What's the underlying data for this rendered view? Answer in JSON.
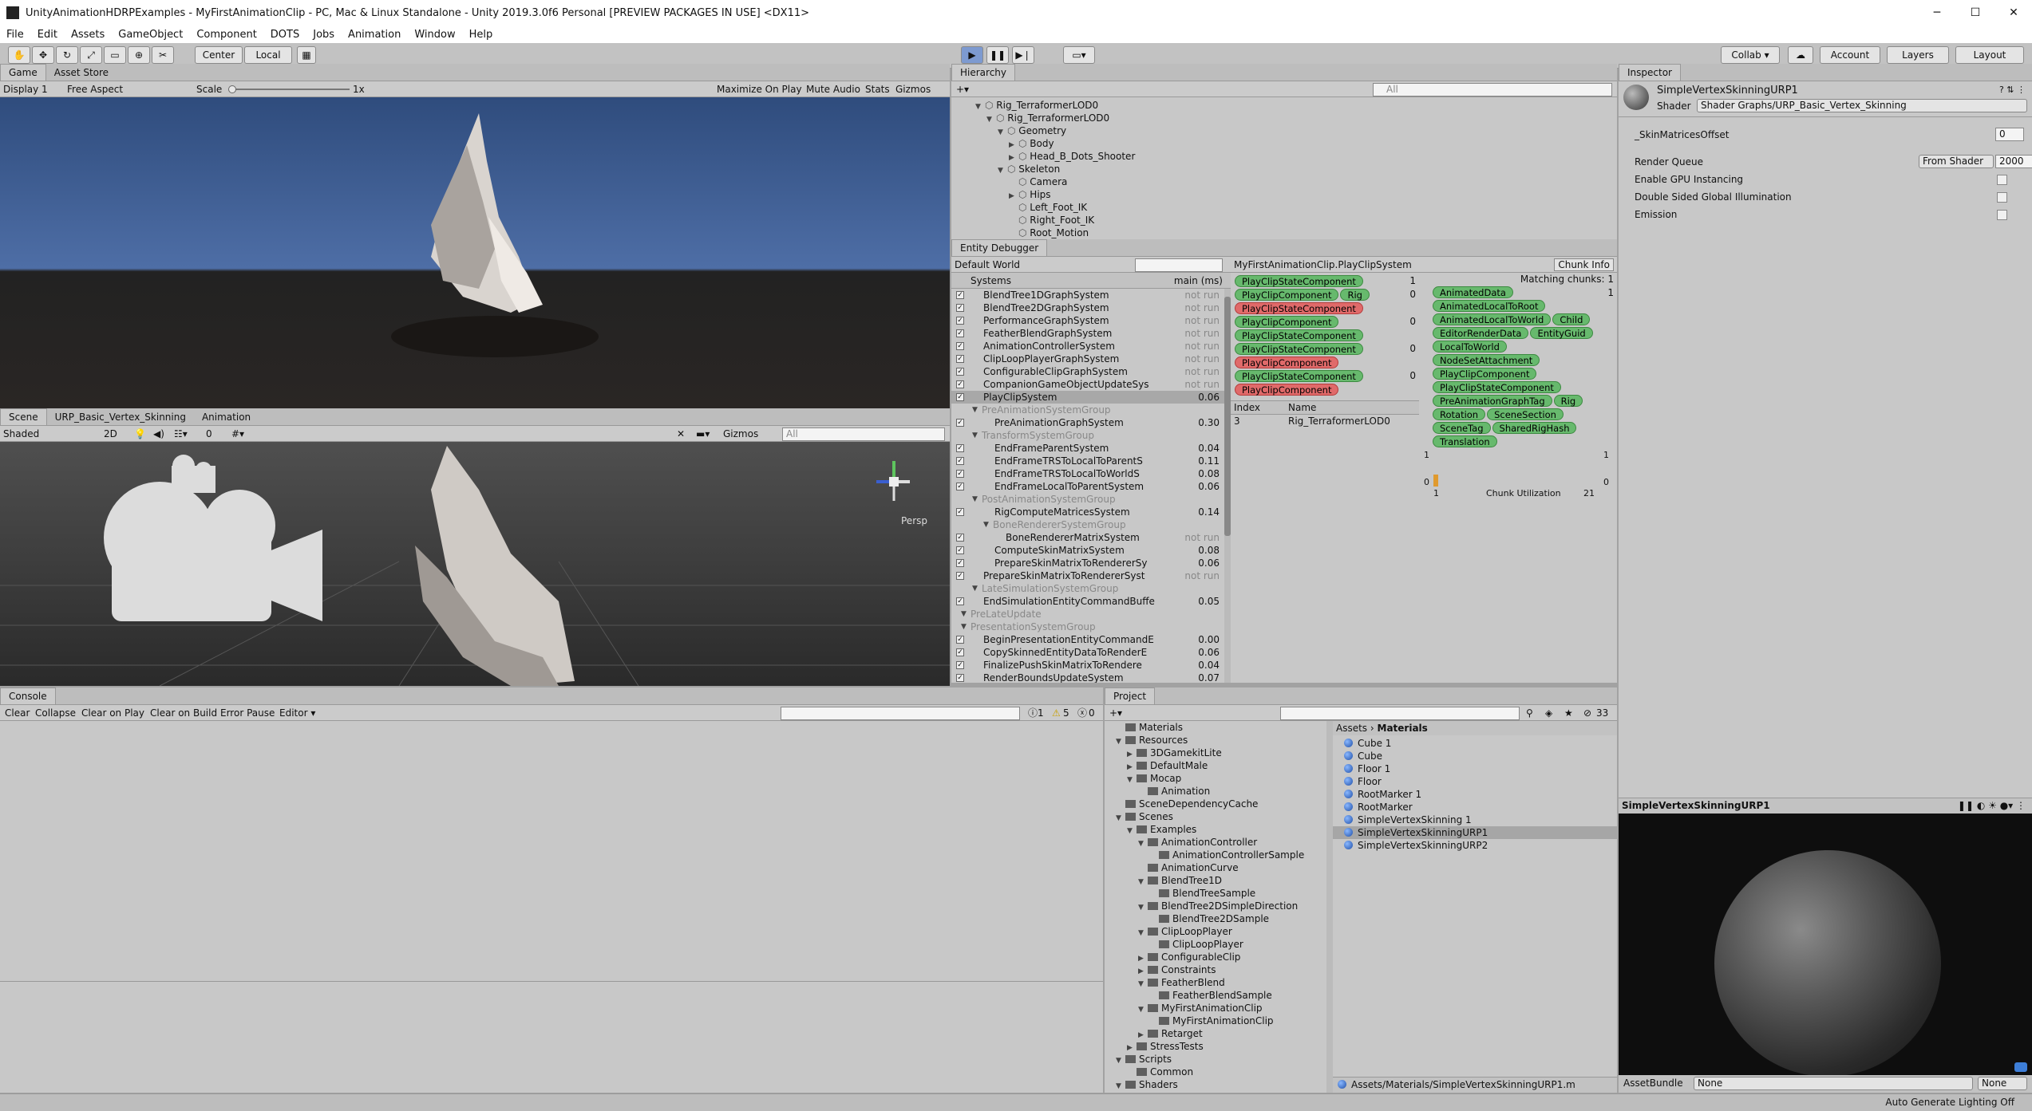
{
  "window": {
    "title": "UnityAnimationHDRPExamples - MyFirstAnimationClip - PC, Mac & Linux Standalone - Unity 2019.3.0f6 Personal [PREVIEW PACKAGES IN USE] <DX11>",
    "minimize": "─",
    "maximize": "☐",
    "close": "✕"
  },
  "menu": [
    "File",
    "Edit",
    "Assets",
    "GameObject",
    "Component",
    "DOTS",
    "Jobs",
    "Animation",
    "Window",
    "Help"
  ],
  "toolbar": {
    "center": "Center",
    "local": "Local",
    "collab": "Collab ▾",
    "account": "Account",
    "layers": "Layers",
    "layout": "Layout"
  },
  "game": {
    "tab": "Game",
    "tab2": "Asset Store",
    "display": "Display 1",
    "aspect": "Free Aspect",
    "scale_label": "Scale",
    "scale_value": "1x",
    "maximize": "Maximize On Play",
    "mute": "Mute Audio",
    "stats": "Stats",
    "gizmos": "Gizmos"
  },
  "scene": {
    "tab": "Scene",
    "tab2": "URP_Basic_Vertex_Skinning",
    "tab3": "Animation",
    "shading": "Shaded",
    "mode2d": "2D",
    "gizmos": "Gizmos",
    "search_placeholder": "All",
    "persp": "Persp",
    "layer_count": "0"
  },
  "hierarchy": {
    "tab": "Hierarchy",
    "search_placeholder": "All",
    "items": [
      {
        "label": "Rig_TerraformerLOD0",
        "depth": 0,
        "arrow": "▼"
      },
      {
        "label": "Rig_TerraformerLOD0",
        "depth": 1,
        "arrow": "▼"
      },
      {
        "label": "Geometry",
        "depth": 2,
        "arrow": "▼"
      },
      {
        "label": "Body",
        "depth": 3,
        "arrow": "▶"
      },
      {
        "label": "Head_B_Dots_Shooter",
        "depth": 3,
        "arrow": "▶"
      },
      {
        "label": "Skeleton",
        "depth": 2,
        "arrow": "▼"
      },
      {
        "label": "Camera",
        "depth": 3,
        "arrow": ""
      },
      {
        "label": "Hips",
        "depth": 3,
        "arrow": "▶"
      },
      {
        "label": "Left_Foot_IK",
        "depth": 3,
        "arrow": ""
      },
      {
        "label": "Right_Foot_IK",
        "depth": 3,
        "arrow": ""
      },
      {
        "label": "Root_Motion",
        "depth": 3,
        "arrow": ""
      }
    ]
  },
  "entity_debugger": {
    "tab": "Entity Debugger",
    "world": "Default World",
    "systems_header": "Systems",
    "main_header": "main (ms)",
    "systems": [
      {
        "label": "BlendTree1DGraphSystem",
        "time": "not run",
        "indent": 1,
        "checked": true,
        "group": false
      },
      {
        "label": "BlendTree2DGraphSystem",
        "time": "not run",
        "indent": 1,
        "checked": true,
        "group": false
      },
      {
        "label": "PerformanceGraphSystem",
        "time": "not run",
        "indent": 1,
        "checked": true,
        "group": false
      },
      {
        "label": "FeatherBlendGraphSystem",
        "time": "not run",
        "indent": 1,
        "checked": true,
        "group": false
      },
      {
        "label": "AnimationControllerSystem",
        "time": "not run",
        "indent": 1,
        "checked": true,
        "group": false
      },
      {
        "label": "ClipLoopPlayerGraphSystem",
        "time": "not run",
        "indent": 1,
        "checked": true,
        "group": false
      },
      {
        "label": "ConfigurableClipGraphSystem",
        "time": "not run",
        "indent": 1,
        "checked": true,
        "group": false
      },
      {
        "label": "CompanionGameObjectUpdateSys",
        "time": "not run",
        "indent": 1,
        "checked": true,
        "group": false
      },
      {
        "label": "PlayClipSystem",
        "time": "0.06",
        "indent": 1,
        "checked": true,
        "group": false,
        "selected": true
      },
      {
        "label": "PreAnimationSystemGroup",
        "time": "",
        "indent": 1,
        "checked": false,
        "group": true
      },
      {
        "label": "PreAnimationGraphSystem",
        "time": "0.30",
        "indent": 2,
        "checked": true,
        "group": false
      },
      {
        "label": "TransformSystemGroup",
        "time": "",
        "indent": 1,
        "checked": false,
        "group": true
      },
      {
        "label": "EndFrameParentSystem",
        "time": "0.04",
        "indent": 2,
        "checked": true,
        "group": false
      },
      {
        "label": "EndFrameTRSToLocalToParentS",
        "time": "0.11",
        "indent": 2,
        "checked": true,
        "group": false
      },
      {
        "label": "EndFrameTRSToLocalToWorldS",
        "time": "0.08",
        "indent": 2,
        "checked": true,
        "group": false
      },
      {
        "label": "EndFrameLocalToParentSystem",
        "time": "0.06",
        "indent": 2,
        "checked": true,
        "group": false
      },
      {
        "label": "PostAnimationSystemGroup",
        "time": "",
        "indent": 1,
        "checked": false,
        "group": true
      },
      {
        "label": "RigComputeMatricesSystem",
        "time": "0.14",
        "indent": 2,
        "checked": true,
        "group": false
      },
      {
        "label": "BoneRendererSystemGroup",
        "time": "",
        "indent": 2,
        "checked": false,
        "group": true
      },
      {
        "label": "BoneRendererMatrixSystem",
        "time": "not run",
        "indent": 3,
        "checked": true,
        "group": false
      },
      {
        "label": "ComputeSkinMatrixSystem",
        "time": "0.08",
        "indent": 2,
        "checked": true,
        "group": false
      },
      {
        "label": "PrepareSkinMatrixToRendererSy",
        "time": "0.06",
        "indent": 2,
        "checked": true,
        "group": false
      },
      {
        "label": "PrepareSkinMatrixToRendererSyst",
        "time": "not run",
        "indent": 1,
        "checked": true,
        "group": false
      },
      {
        "label": "LateSimulationSystemGroup",
        "time": "",
        "indent": 1,
        "checked": false,
        "group": true
      },
      {
        "label": "EndSimulationEntityCommandBuffe",
        "time": "0.05",
        "indent": 1,
        "checked": true,
        "group": false
      },
      {
        "label": "PreLateUpdate",
        "time": "",
        "indent": 0,
        "checked": false,
        "group": true
      },
      {
        "label": "PresentationSystemGroup",
        "time": "",
        "indent": 0,
        "checked": false,
        "group": true
      },
      {
        "label": "BeginPresentationEntityCommandE",
        "time": "0.00",
        "indent": 1,
        "checked": true,
        "group": false
      },
      {
        "label": "CopySkinnedEntityDataToRenderE",
        "time": "0.06",
        "indent": 1,
        "checked": true,
        "group": false
      },
      {
        "label": "FinalizePushSkinMatrixToRendere",
        "time": "0.04",
        "indent": 1,
        "checked": true,
        "group": false
      },
      {
        "label": "RenderBoundsUpdateSystem",
        "time": "0.07",
        "indent": 1,
        "checked": true,
        "group": false
      }
    ],
    "query_title": "MyFirstAnimationClip.PlayClipSystem",
    "chunk_info": "Chunk Info",
    "queries": [
      {
        "pills": [
          {
            "t": "PlayClipStateComponent",
            "red": false
          }
        ],
        "count": "1"
      },
      {
        "pills": [
          {
            "t": "PlayClipComponent",
            "red": false
          },
          {
            "t": "Rig",
            "red": false
          }
        ],
        "count": "0"
      },
      {
        "pills": [
          {
            "t": "PlayClipStateComponent",
            "red": true
          }
        ],
        "count": ""
      },
      {
        "pills": [
          {
            "t": "PlayClipComponent",
            "red": false
          }
        ],
        "count": "0"
      },
      {
        "pills": [
          {
            "t": "PlayClipStateComponent",
            "red": false
          }
        ],
        "count": ""
      },
      {
        "pills": [
          {
            "t": "PlayClipStateComponent",
            "red": false
          }
        ],
        "count": "0"
      },
      {
        "pills": [
          {
            "t": "PlayClipComponent",
            "red": true
          }
        ],
        "count": ""
      },
      {
        "pills": [
          {
            "t": "PlayClipStateComponent",
            "red": false
          }
        ],
        "count": "0"
      },
      {
        "pills": [
          {
            "t": "PlayClipComponent",
            "red": true
          }
        ],
        "count": ""
      }
    ],
    "index_header": "Index",
    "name_header": "Name",
    "entity_index": "3",
    "entity_name": "Rig_TerraformerLOD0",
    "matching_chunks": "Matching chunks: 1",
    "chunk_count": "1",
    "archetype_rows": [
      [
        "AnimatedData"
      ],
      [
        "AnimatedLocalToRoot"
      ],
      [
        "AnimatedLocalToWorld",
        "Child"
      ],
      [
        "EditorRenderData",
        "EntityGuid"
      ],
      [
        "LocalToWorld"
      ],
      [
        "NodeSetAttachment"
      ],
      [
        "PlayClipComponent"
      ],
      [
        "PlayClipStateComponent"
      ],
      [
        "PreAnimationGraphTag",
        "Rig"
      ],
      [
        "Rotation",
        "SceneSection"
      ],
      [
        "SceneTag",
        "SharedRigHash"
      ],
      [
        "Translation"
      ]
    ],
    "chunk_util_label": "Chunk Utilization",
    "chunk_axis_min": "1",
    "chunk_axis_max": "21",
    "chunk_y_top": "1",
    "chunk_y_bottom": "0",
    "chunk_right_top": "1",
    "chunk_right_bottom": "0",
    "chunk_fill": 0.33
  },
  "console": {
    "tab": "Console",
    "clear": "Clear",
    "collapse": "Collapse",
    "clear_on_play": "Clear on Play",
    "clear_on_build": "Clear on Build",
    "error_pause": "Error Pause",
    "editor": "Editor ▾",
    "info_count": "1",
    "warn_count": "5",
    "error_count": "0"
  },
  "project": {
    "tab": "Project",
    "count": "33",
    "breadcrumb_root": "Assets",
    "breadcrumb_leaf": "Materials",
    "tree": [
      {
        "label": "Materials",
        "depth": 1,
        "arrow": ""
      },
      {
        "label": "Resources",
        "depth": 1,
        "arrow": "▼"
      },
      {
        "label": "3DGamekitLite",
        "depth": 2,
        "arrow": "▶"
      },
      {
        "label": "DefaultMale",
        "depth": 2,
        "arrow": "▶"
      },
      {
        "label": "Mocap",
        "depth": 2,
        "arrow": "▼"
      },
      {
        "label": "Animation",
        "depth": 3,
        "arrow": ""
      },
      {
        "label": "SceneDependencyCache",
        "depth": 1,
        "arrow": ""
      },
      {
        "label": "Scenes",
        "depth": 1,
        "arrow": "▼"
      },
      {
        "label": "Examples",
        "depth": 2,
        "arrow": "▼"
      },
      {
        "label": "AnimationController",
        "depth": 3,
        "arrow": "▼"
      },
      {
        "label": "AnimationControllerSample",
        "depth": 4,
        "arrow": ""
      },
      {
        "label": "AnimationCurve",
        "depth": 3,
        "arrow": ""
      },
      {
        "label": "BlendTree1D",
        "depth": 3,
        "arrow": "▼"
      },
      {
        "label": "BlendTreeSample",
        "depth": 4,
        "arrow": ""
      },
      {
        "label": "BlendTree2DSimpleDirection",
        "depth": 3,
        "arrow": "▼"
      },
      {
        "label": "BlendTree2DSample",
        "depth": 4,
        "arrow": ""
      },
      {
        "label": "ClipLoopPlayer",
        "depth": 3,
        "arrow": "▼"
      },
      {
        "label": "ClipLoopPlayer",
        "depth": 4,
        "arrow": ""
      },
      {
        "label": "ConfigurableClip",
        "depth": 3,
        "arrow": "▶"
      },
      {
        "label": "Constraints",
        "depth": 3,
        "arrow": "▶"
      },
      {
        "label": "FeatherBlend",
        "depth": 3,
        "arrow": "▼"
      },
      {
        "label": "FeatherBlendSample",
        "depth": 4,
        "arrow": ""
      },
      {
        "label": "MyFirstAnimationClip",
        "depth": 3,
        "arrow": "▼"
      },
      {
        "label": "MyFirstAnimationClip",
        "depth": 4,
        "arrow": ""
      },
      {
        "label": "Retarget",
        "depth": 3,
        "arrow": "▶"
      },
      {
        "label": "StressTests",
        "depth": 2,
        "arrow": "▶"
      },
      {
        "label": "Scripts",
        "depth": 1,
        "arrow": "▼"
      },
      {
        "label": "Common",
        "depth": 2,
        "arrow": ""
      },
      {
        "label": "Shaders",
        "depth": 1,
        "arrow": "▼"
      }
    ],
    "assets": [
      {
        "label": "Cube 1",
        "selected": false
      },
      {
        "label": "Cube",
        "selected": false
      },
      {
        "label": "Floor 1",
        "selected": false
      },
      {
        "label": "Floor",
        "selected": false
      },
      {
        "label": "RootMarker 1",
        "selected": false
      },
      {
        "label": "RootMarker",
        "selected": false
      },
      {
        "label": "SimpleVertexSkinning 1",
        "selected": false
      },
      {
        "label": "SimpleVertexSkinningURP1",
        "selected": true
      },
      {
        "label": "SimpleVertexSkinningURP2",
        "selected": false
      }
    ],
    "path": "Assets/Materials/SimpleVertexSkinningURP1.m"
  },
  "inspector": {
    "tab": "Inspector",
    "name": "SimpleVertexSkinningURP1",
    "shader_label": "Shader",
    "shader_value": "Shader Graphs/URP_Basic_Vertex_Skinning",
    "skin_offset_label": "_SkinMatricesOffset",
    "skin_offset_value": "0",
    "render_queue_label": "Render Queue",
    "render_queue_mode": "From Shader",
    "render_queue_value": "2000",
    "gpu_instancing": "Enable GPU Instancing",
    "double_sided": "Double Sided Global Illumination",
    "emission": "Emission",
    "preview_title": "SimpleVertexSkinningURP1",
    "assetbundle_label": "AssetBundle",
    "assetbundle_value": "None",
    "assetbundle_variant": "None"
  },
  "status": {
    "right": "Auto Generate Lighting Off"
  }
}
